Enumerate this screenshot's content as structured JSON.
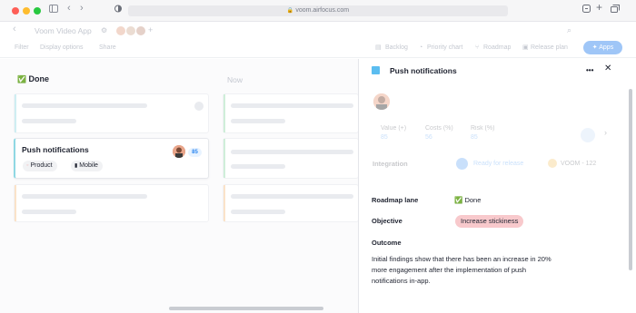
{
  "browser": {
    "url": "voom.airfocus.com",
    "nav_back": "‹",
    "nav_forward": "›",
    "lock_icon": "🔒"
  },
  "app": {
    "back_glyph": "‹",
    "workspace_title": "Voom Video App",
    "settings_glyph": "⚙",
    "add_glyph": "+"
  },
  "toolbar": {
    "filter": "Filter",
    "display_options": "Display options",
    "share": "Share",
    "backlog": "Backlog",
    "priority_chart": "Priority chart",
    "roadmap": "Roadmap",
    "release_plan": "Release plan",
    "apps": "Apps"
  },
  "board": {
    "columns": [
      {
        "title": "Done",
        "emoji": "✅"
      },
      {
        "title": "Now"
      }
    ],
    "card": {
      "title": "Push notifications",
      "tags": [
        "Product",
        "Mobile"
      ],
      "score": "85"
    }
  },
  "panel": {
    "title": "Push notifications",
    "more_glyph": "•••",
    "close_glyph": "✕",
    "metrics": [
      {
        "label": "Value (+)",
        "value": "85"
      },
      {
        "label": "Costs (%)",
        "value": "56"
      },
      {
        "label": "Risk (%)",
        "value": "85"
      }
    ],
    "integration": {
      "label": "Integration",
      "status": "Ready for release",
      "ticket": "VOOM - 122"
    },
    "roadmap_lane": {
      "label": "Roadmap lane",
      "emoji": "✅",
      "value": "Done"
    },
    "objective": {
      "label": "Objective",
      "value": "Increase stickiness"
    },
    "outcome": {
      "label": "Outcome",
      "lines": [
        "Initial findings show that there has been an increase in 20%",
        "more engagement after the implementation of push",
        "notifications in-app."
      ]
    }
  },
  "colors": {
    "accent_blue": "#2b86f0",
    "done_green": "#35b24a",
    "objective_pink": "#f8c9cc",
    "panel_square": "#5bbdf0"
  }
}
